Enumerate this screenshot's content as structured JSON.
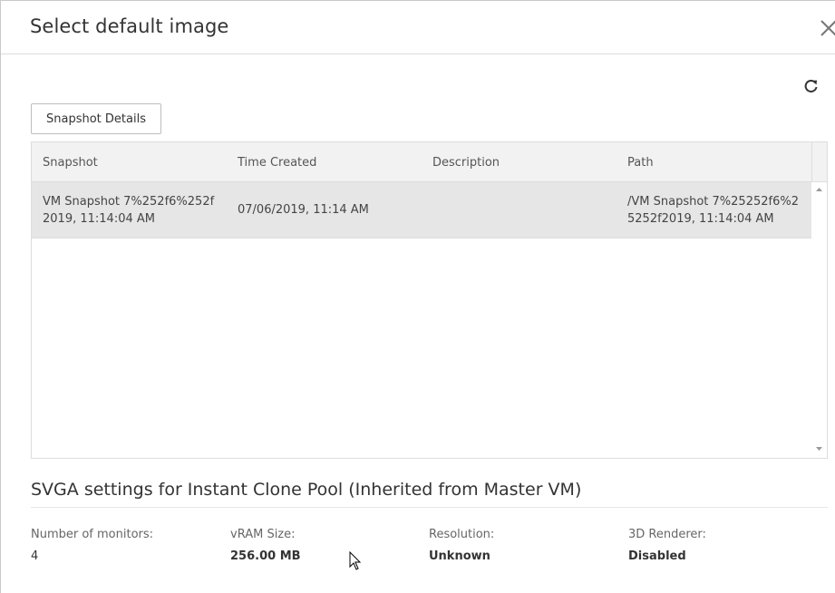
{
  "dialog": {
    "title": "Select default image",
    "close_icon": "close-icon",
    "refresh_icon": "refresh-icon"
  },
  "toolbar": {
    "snapshot_details_label": "Snapshot Details"
  },
  "grid": {
    "columns": [
      "Snapshot",
      "Time Created",
      "Description",
      "Path"
    ],
    "rows": [
      {
        "snapshot_line1": "VM Snapshot 7%252f6%252f",
        "snapshot_line2": "2019, 11:14:04 AM",
        "time_created": "07/06/2019, 11:14 AM",
        "description": "",
        "path_line1": "/VM Snapshot 7%25252f6%2",
        "path_line2": "5252f2019, 11:14:04 AM",
        "selected": true
      }
    ]
  },
  "svga": {
    "title": "SVGA settings for Instant Clone Pool (Inherited from Master VM)",
    "settings": [
      {
        "label": "Number of monitors:",
        "value": "4"
      },
      {
        "label": "vRAM Size:",
        "value": "256.00 MB"
      },
      {
        "label": "Resolution:",
        "value": "Unknown"
      },
      {
        "label": "3D Renderer:",
        "value": "Disabled"
      }
    ]
  },
  "colors": {
    "selected_row": "#e6e6e6",
    "header_bg": "#f2f2f2",
    "border": "#dddddd"
  }
}
